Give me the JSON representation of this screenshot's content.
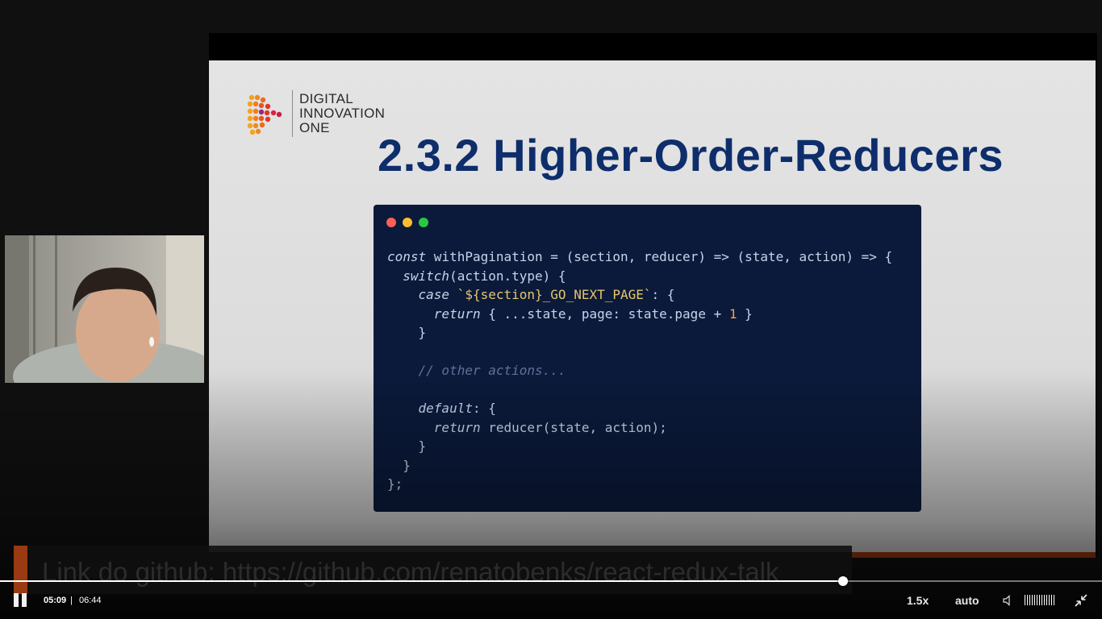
{
  "slide": {
    "logo_lines": [
      "DIGITAL",
      "INNOVATION",
      "ONE"
    ],
    "title": "2.3.2 Higher-Order-Reducers",
    "code_lines": [
      "const withPagination = (section, reducer) => (state, action) => {",
      "  switch(action.type) {",
      "    case `${section}_GO_NEXT_PAGE`: {",
      "      return { ...state, page: state.page + 1 }",
      "    }",
      "",
      "    // other actions...",
      "",
      "    default: {",
      "      return reducer(state, action);",
      "    }",
      "  }",
      "};"
    ],
    "window_dot_colors": [
      "#ff5f56",
      "#ffbd2e",
      "#27c93f"
    ]
  },
  "caption": {
    "text": "Link do github: https://github.com/renatobenks/react-redux-talk"
  },
  "player": {
    "current_time": "05:09",
    "separator": "|",
    "duration": "06:44",
    "progress": 0.765,
    "playback_rate": "1.5x",
    "quality": "auto",
    "volume_level": 1.0
  },
  "colors": {
    "accent": "#9a3a12",
    "title_blue": "#0e2d6b",
    "code_bg": "#0b1a3b"
  }
}
